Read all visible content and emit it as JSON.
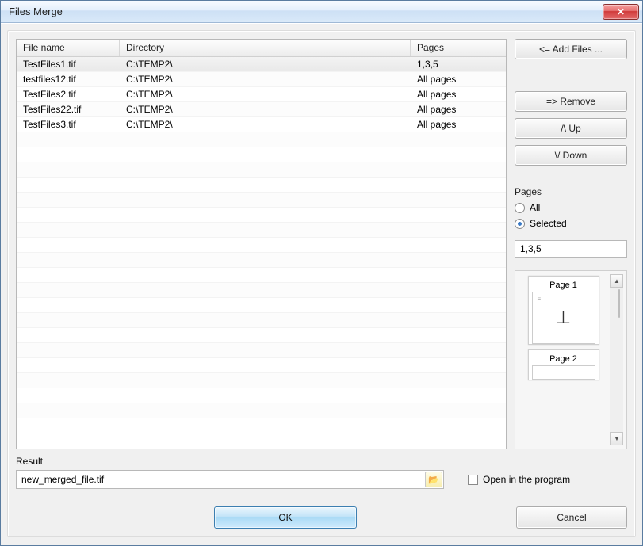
{
  "window": {
    "title": "Files Merge"
  },
  "table": {
    "columns": {
      "file_name": "File name",
      "directory": "Directory",
      "pages": "Pages"
    },
    "rows": [
      {
        "file_name": "TestFiles1.tif",
        "directory": "C:\\TEMP2\\",
        "pages": "1,3,5",
        "selected": true
      },
      {
        "file_name": "testfiles12.tif",
        "directory": "C:\\TEMP2\\",
        "pages": "All pages",
        "selected": false
      },
      {
        "file_name": "TestFiles2.tif",
        "directory": "C:\\TEMP2\\",
        "pages": "All pages",
        "selected": false
      },
      {
        "file_name": "TestFiles22.tif",
        "directory": "C:\\TEMP2\\",
        "pages": "All pages",
        "selected": false
      },
      {
        "file_name": "TestFiles3.tif",
        "directory": "C:\\TEMP2\\",
        "pages": "All pages",
        "selected": false
      }
    ]
  },
  "buttons": {
    "add_files": "<=  Add Files ...",
    "remove": "=>   Remove",
    "up": "/\\   Up",
    "down": "\\/   Down",
    "ok": "OK",
    "cancel": "Cancel"
  },
  "pages_panel": {
    "label": "Pages",
    "opt_all": "All",
    "opt_selected": "Selected",
    "selection": "Selected",
    "input_value": "1,3,5"
  },
  "preview": {
    "pages": [
      {
        "caption": "Page 1",
        "mark": "⊥"
      },
      {
        "caption": "Page 2",
        "mark": ""
      }
    ]
  },
  "result": {
    "label": "Result",
    "value": "new_merged_file.tif",
    "open_label": "Open in the program",
    "open_checked": false
  }
}
